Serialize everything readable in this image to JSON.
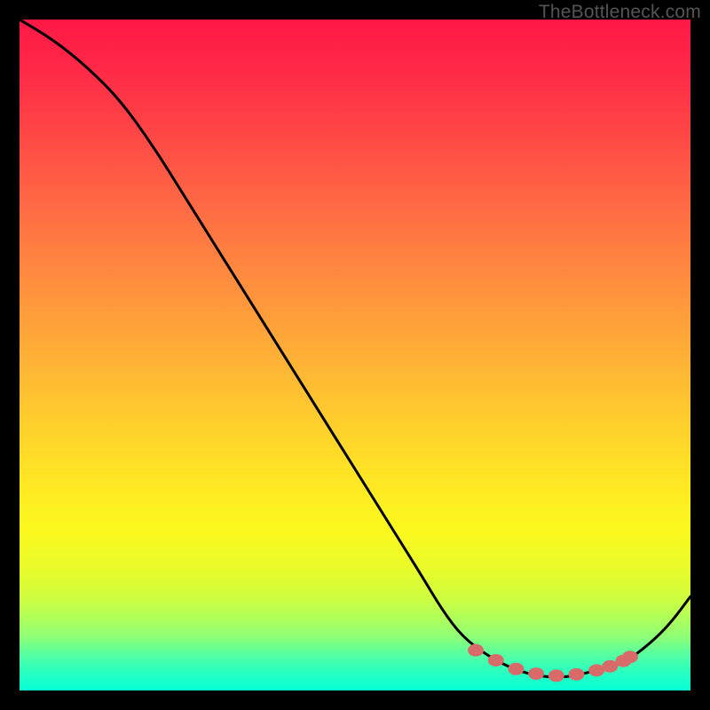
{
  "watermark": "TheBottleneck.com",
  "chart_data": {
    "type": "line",
    "title": "",
    "xlabel": "",
    "ylabel": "",
    "xlim": [
      0,
      100
    ],
    "ylim": [
      0,
      100
    ],
    "series": [
      {
        "name": "bottleneck-curve",
        "x": [
          0,
          5,
          10,
          15,
          20,
          25,
          30,
          35,
          40,
          45,
          50,
          55,
          60,
          63,
          66,
          70,
          74,
          78,
          82,
          86,
          90,
          94,
          97,
          100
        ],
        "y": [
          100,
          97,
          93,
          88,
          81,
          73,
          65,
          57,
          49,
          41,
          33,
          25,
          17,
          12,
          8,
          5,
          3,
          2,
          2,
          3,
          4,
          7,
          10,
          14
        ]
      }
    ],
    "markers": {
      "name": "highlight-dots",
      "x": [
        68,
        71,
        74,
        77,
        80,
        83,
        86,
        88,
        90,
        91
      ],
      "y": [
        6.0,
        4.5,
        3.2,
        2.5,
        2.2,
        2.4,
        3.0,
        3.6,
        4.4,
        5.0
      ]
    },
    "colors": {
      "curve": "#000000",
      "marker": "#d96a6a"
    }
  }
}
